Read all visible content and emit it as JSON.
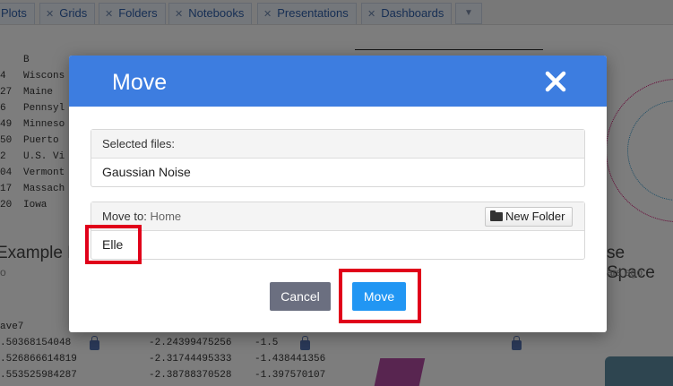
{
  "tabs": [
    {
      "label": "Plots"
    },
    {
      "label": "Grids"
    },
    {
      "label": "Folders"
    },
    {
      "label": "Notebooks"
    },
    {
      "label": "Presentations"
    },
    {
      "label": "Dashboards"
    }
  ],
  "background": {
    "grid_header": "B",
    "grid_rows": [
      {
        "num": "4",
        "state": "Wiscons"
      },
      {
        "num": "27",
        "state": "Maine"
      },
      {
        "num": "6",
        "state": "Pennsyl"
      },
      {
        "num": "49",
        "state": "Minneso"
      },
      {
        "num": "50",
        "state": "Puerto"
      },
      {
        "num": "2",
        "state": "U.S. Vi"
      },
      {
        "num": "04",
        "state": "Vermont"
      },
      {
        "num": "17",
        "state": "Massach"
      },
      {
        "num": "20",
        "state": "Iowa"
      }
    ],
    "card_left_title": "Example D",
    "card_left_sub": "o",
    "card_right_title": "se Space",
    "card_right_sub": "ars ago",
    "col1_header": "ave7",
    "col1_values": [
      ".50368154048",
      ".526866614819",
      ".553525984287"
    ],
    "col2_values": [
      [
        "-2.24399475256",
        "-1.5"
      ],
      [
        "-2.31744495333",
        "-1.438441356"
      ],
      [
        "-2.38788370528",
        "-1.397570107"
      ]
    ]
  },
  "modal": {
    "title": "Move",
    "selected_files_label": "Selected files:",
    "selected_file": "Gaussian Noise",
    "move_to_label": "Move to:",
    "move_to_path": "Home",
    "new_folder_label": "New Folder",
    "folder_item": "Elle",
    "cancel_label": "Cancel",
    "move_label": "Move"
  },
  "colors": {
    "header_blue": "#3d7de0",
    "move_button": "#2196f3",
    "cancel_button": "#6b6f80",
    "highlight": "#e0001a"
  },
  "icons": {
    "close": "close-icon",
    "folder": "folder-icon",
    "tab_close": "tab-close-icon",
    "tab_more": "chevron-down-icon",
    "lock": "lock-icon"
  }
}
